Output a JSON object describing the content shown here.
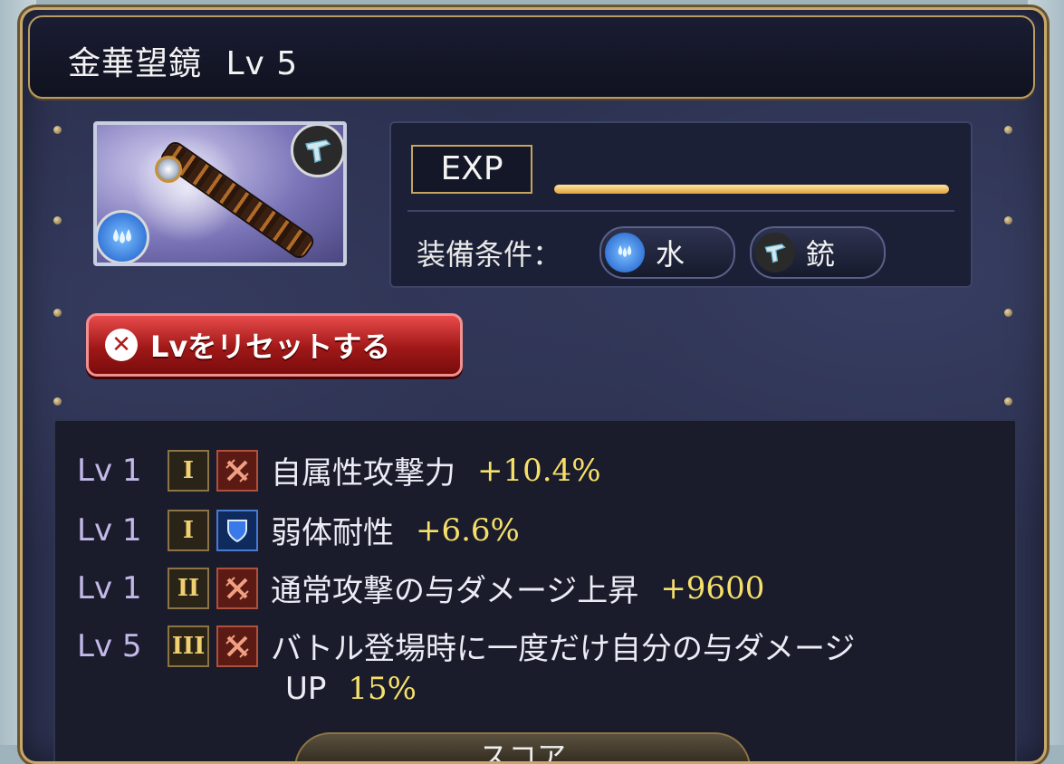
{
  "item": {
    "name": "金華望鏡",
    "level_label": "Lv 5"
  },
  "exp": {
    "label": "EXP",
    "progress": 1.0
  },
  "equip": {
    "label": "装備条件：",
    "conditions": [
      {
        "icon": "water-drop-icon",
        "text": "水"
      },
      {
        "icon": "gun-icon",
        "text": "銃"
      }
    ]
  },
  "reset_button": {
    "label": "Lvをリセットする"
  },
  "skills": [
    {
      "level": "Lv 1",
      "rank": "I",
      "type": "attack",
      "name": "自属性攻撃力",
      "value": "+10.4%"
    },
    {
      "level": "Lv 1",
      "rank": "I",
      "type": "defense",
      "name": "弱体耐性",
      "value": "+6.6%"
    },
    {
      "level": "Lv 1",
      "rank": "II",
      "type": "attack",
      "name": "通常攻撃の与ダメージ上昇",
      "value": "+9600"
    },
    {
      "level": "Lv 5",
      "rank": "III",
      "type": "attack",
      "name": "バトル登場時に一度だけ自分の与ダメージ",
      "name2": "UP",
      "value": "15%"
    }
  ],
  "score_tab": {
    "label": "スコア"
  },
  "colors": {
    "frame_gold": "#c8a86a",
    "panel": "#2c3150",
    "value_yellow": "#f6e06a",
    "button_red": "#c02020"
  }
}
